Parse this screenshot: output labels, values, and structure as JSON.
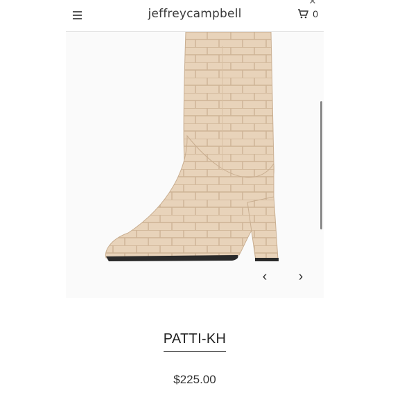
{
  "header": {
    "brand": "jeffreycampbell",
    "cart_count": "0"
  },
  "product": {
    "name": "PATTI-KH",
    "price": "$225.00",
    "image_description_color": "#e6d0b6"
  },
  "icons": {
    "menu": "hamburger-icon",
    "cart": "cart-icon",
    "prev": "chevron-left-icon",
    "next": "chevron-right-icon",
    "close": "close-icon"
  }
}
